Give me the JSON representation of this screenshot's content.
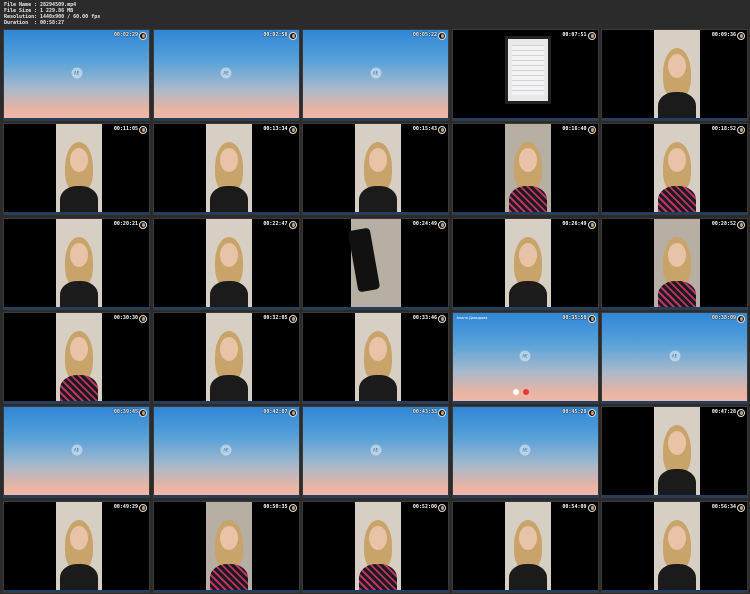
{
  "header": {
    "rows": [
      {
        "key": "File Name",
        "value": ": 28294509.mp4"
      },
      {
        "key": "File Size",
        "value": ": 1 229.86 MB"
      },
      {
        "key": "Resolution",
        "value": ": 1440x900 / 60.00 fps"
      },
      {
        "key": "Duration",
        "value": ": 00:58:27"
      }
    ]
  },
  "avatar_initials": "AE",
  "caller_name": "Алина Давыдова",
  "thumbnails": [
    {
      "time": "00:02:29",
      "kind": "gradient"
    },
    {
      "time": "00:02:58",
      "kind": "gradient"
    },
    {
      "time": "00:05:22",
      "kind": "gradient"
    },
    {
      "time": "00:07:51",
      "kind": "monitor"
    },
    {
      "time": "00:09:36",
      "kind": "person"
    },
    {
      "time": "00:11:05",
      "kind": "person"
    },
    {
      "time": "00:13:34",
      "kind": "person"
    },
    {
      "time": "00:15:43",
      "kind": "person"
    },
    {
      "time": "00:16:40",
      "kind": "person"
    },
    {
      "time": "00:18:52",
      "kind": "person"
    },
    {
      "time": "00:20:21",
      "kind": "person"
    },
    {
      "time": "00:22:47",
      "kind": "person"
    },
    {
      "time": "00:24:49",
      "kind": "phone"
    },
    {
      "time": "00:26:49",
      "kind": "person"
    },
    {
      "time": "00:28:52",
      "kind": "person"
    },
    {
      "time": "00:30:30",
      "kind": "person"
    },
    {
      "time": "00:32:05",
      "kind": "person"
    },
    {
      "time": "00:33:46",
      "kind": "person"
    },
    {
      "time": "00:35:50",
      "kind": "gradient-call"
    },
    {
      "time": "00:38:09",
      "kind": "gradient"
    },
    {
      "time": "00:39:45",
      "kind": "gradient"
    },
    {
      "time": "00:42:07",
      "kind": "gradient"
    },
    {
      "time": "00:43:33",
      "kind": "gradient"
    },
    {
      "time": "00:45:29",
      "kind": "gradient"
    },
    {
      "time": "00:47:28",
      "kind": "person"
    },
    {
      "time": "00:49:29",
      "kind": "person"
    },
    {
      "time": "00:50:35",
      "kind": "person"
    },
    {
      "time": "00:52:00",
      "kind": "person"
    },
    {
      "time": "00:54:09",
      "kind": "person"
    },
    {
      "time": "00:56:34",
      "kind": "person"
    }
  ]
}
